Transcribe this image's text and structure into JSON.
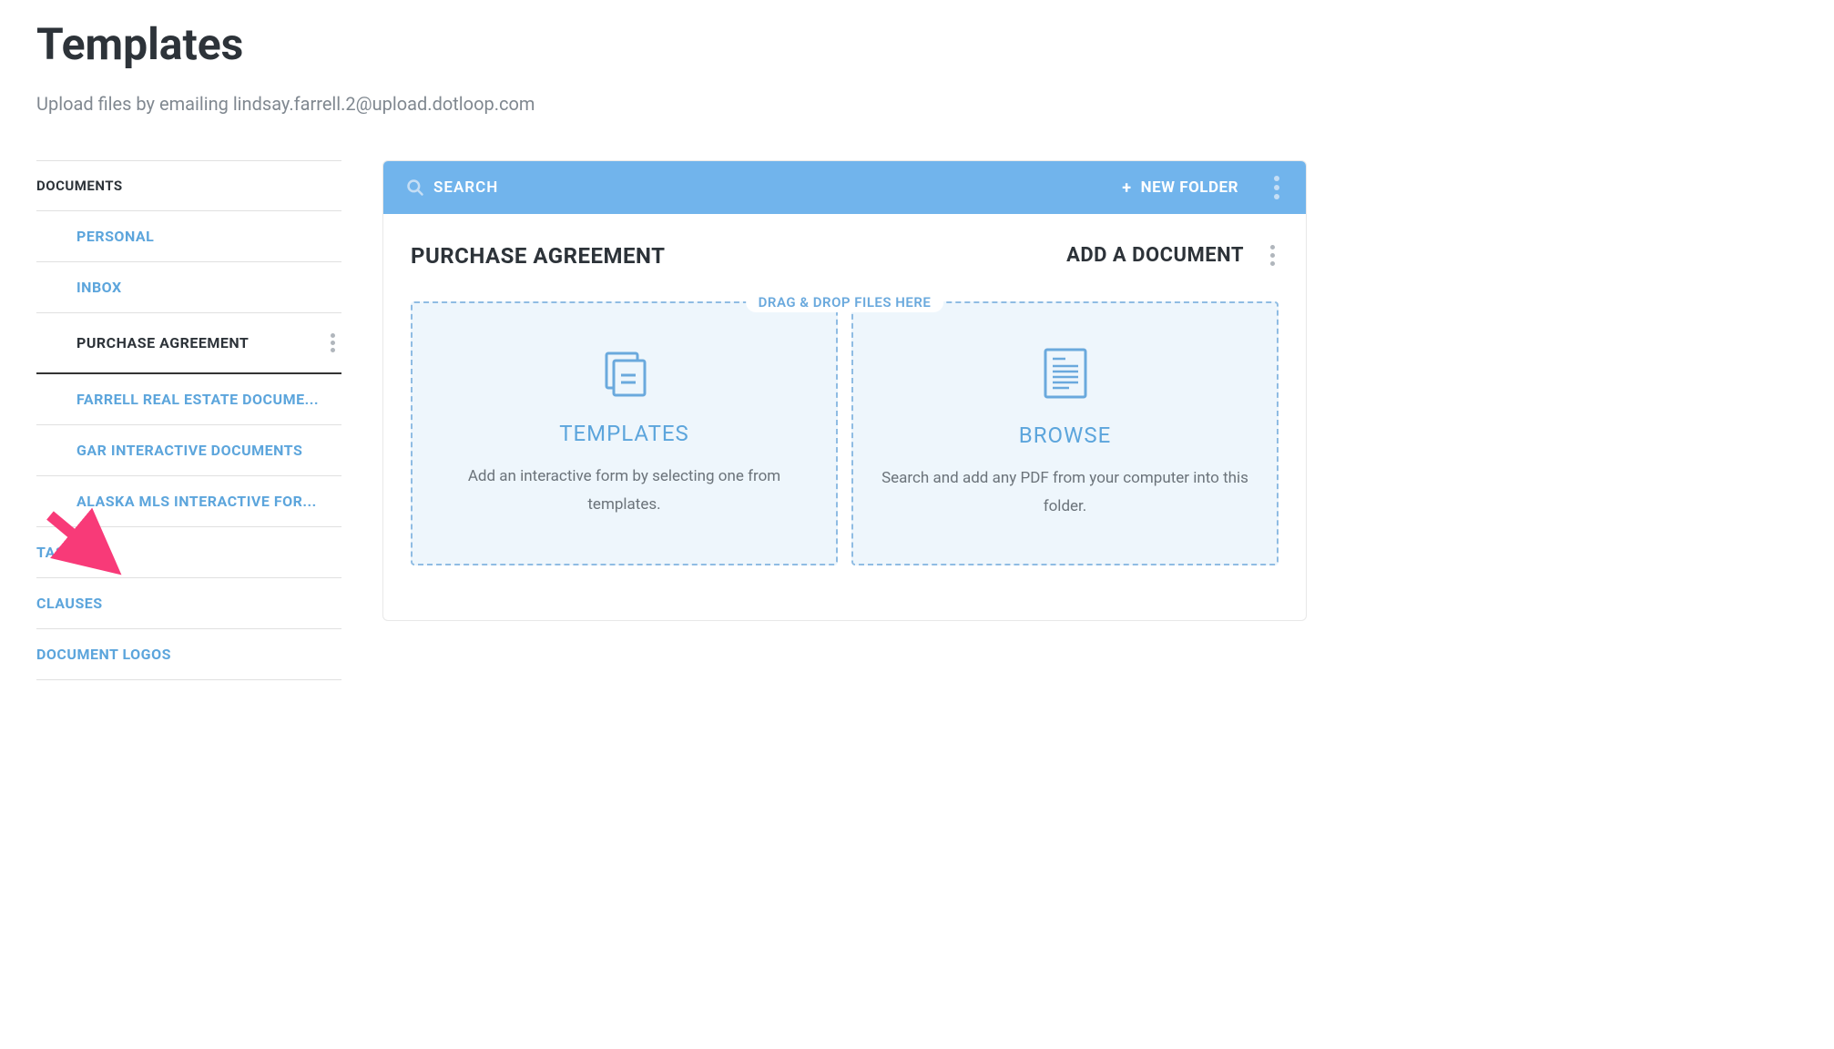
{
  "page": {
    "title": "Templates",
    "upload_hint": "Upload files by emailing lindsay.farrell.2@upload.dotloop.com"
  },
  "sidebar": {
    "section_header": "DOCUMENTS",
    "items": [
      {
        "label": "PERSONAL",
        "active": false
      },
      {
        "label": "INBOX",
        "active": false
      },
      {
        "label": "PURCHASE AGREEMENT",
        "active": true
      },
      {
        "label": "FARRELL REAL ESTATE DOCUME...",
        "active": false
      },
      {
        "label": "GAR INTERACTIVE DOCUMENTS",
        "active": false
      },
      {
        "label": "ALASKA MLS INTERACTIVE FOR...",
        "active": false
      }
    ],
    "bottom": [
      {
        "label": "TASKS"
      },
      {
        "label": "CLAUSES"
      },
      {
        "label": "DOCUMENT LOGOS"
      }
    ]
  },
  "toolbar": {
    "search_label": "SEARCH",
    "new_folder_label": "NEW FOLDER"
  },
  "main": {
    "title": "PURCHASE AGREEMENT",
    "add_document_label": "ADD A DOCUMENT",
    "dragdrop_label": "DRAG & DROP FILES HERE",
    "dropzones": {
      "templates": {
        "title": "TEMPLATES",
        "desc": "Add an interactive form by selecting one from templates."
      },
      "browse": {
        "title": "BROWSE",
        "desc": "Search and add any PDF from your computer into this folder."
      }
    }
  },
  "colors": {
    "accent": "#5ca5dc",
    "toolbar_bg": "#71b4ec",
    "dropzone_bg": "#eef6fc",
    "arrow": "#f83a78"
  }
}
